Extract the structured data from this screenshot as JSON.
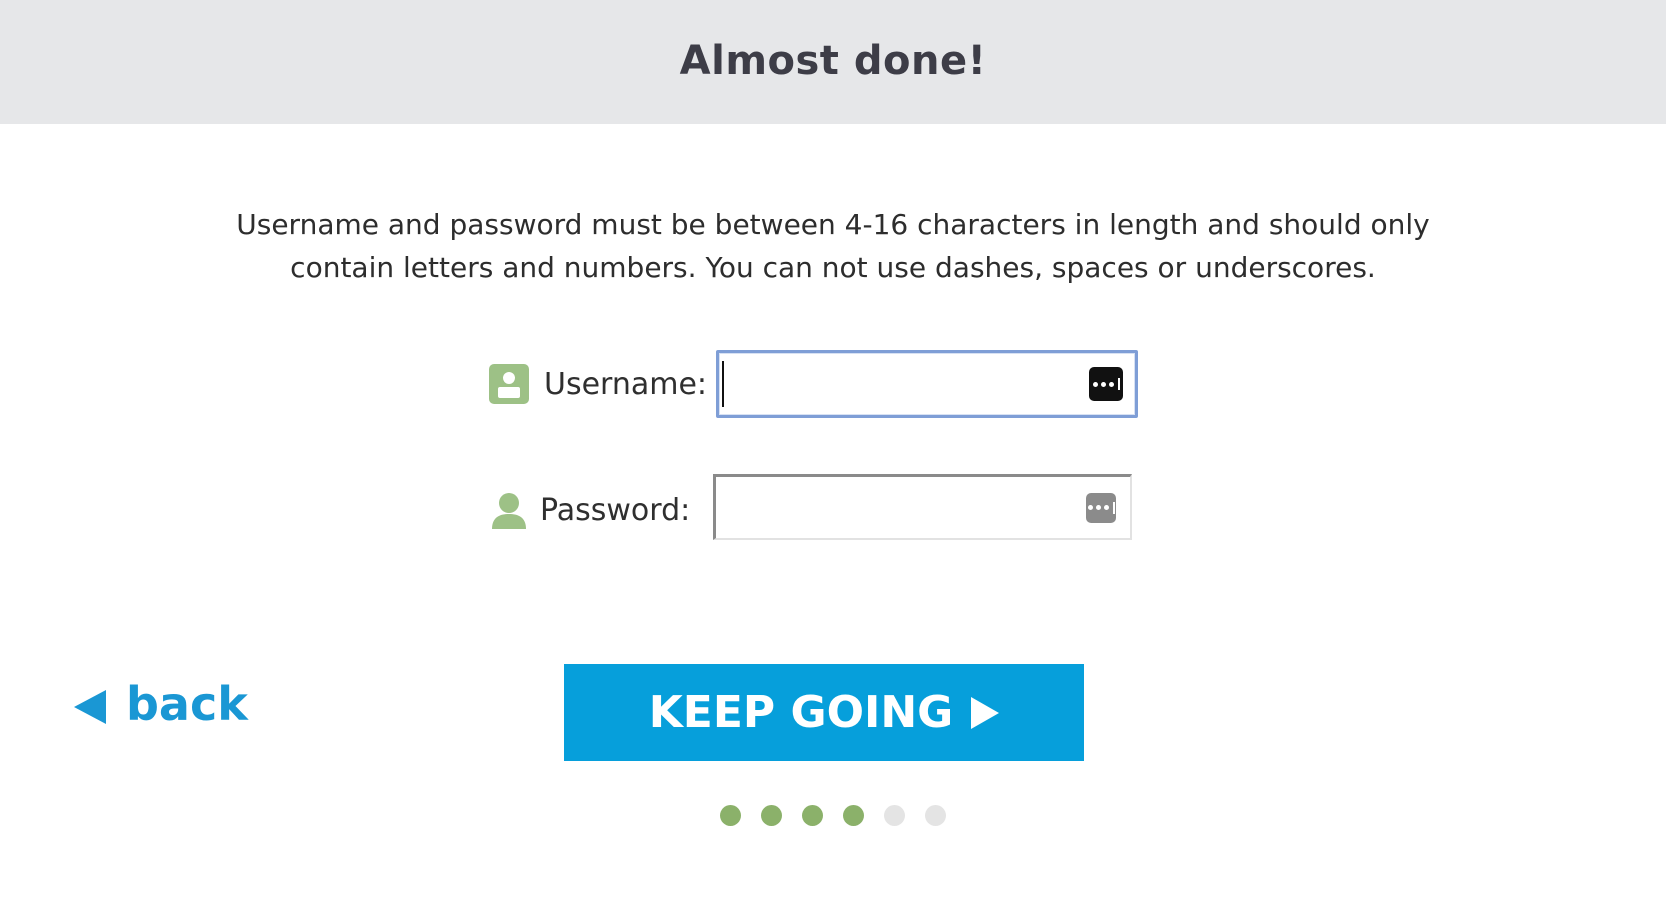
{
  "header": {
    "title": "Almost done!"
  },
  "instructions": {
    "line1": "Username and password must be between 4-16 characters in length and should only",
    "line2": "contain letters and numbers. You can not use dashes, spaces or underscores."
  },
  "form": {
    "username": {
      "label": "Username:",
      "value": "",
      "icon": "id-card-icon"
    },
    "password": {
      "label": "Password:",
      "value": "",
      "icon": "user-icon"
    },
    "keyboard_icon": "keyboard-icon"
  },
  "navigation": {
    "back_label": "back",
    "keep_going_label": "KEEP GOING"
  },
  "progress": {
    "total_steps": 6,
    "completed_steps": 4
  },
  "colors": {
    "header_bg": "#e6e7e9",
    "accent_blue": "#069fdb",
    "link_blue": "#1a97d4",
    "step_done": "#8bb16a",
    "step_todo": "#e4e4e4",
    "icon_green": "#9dc186"
  }
}
